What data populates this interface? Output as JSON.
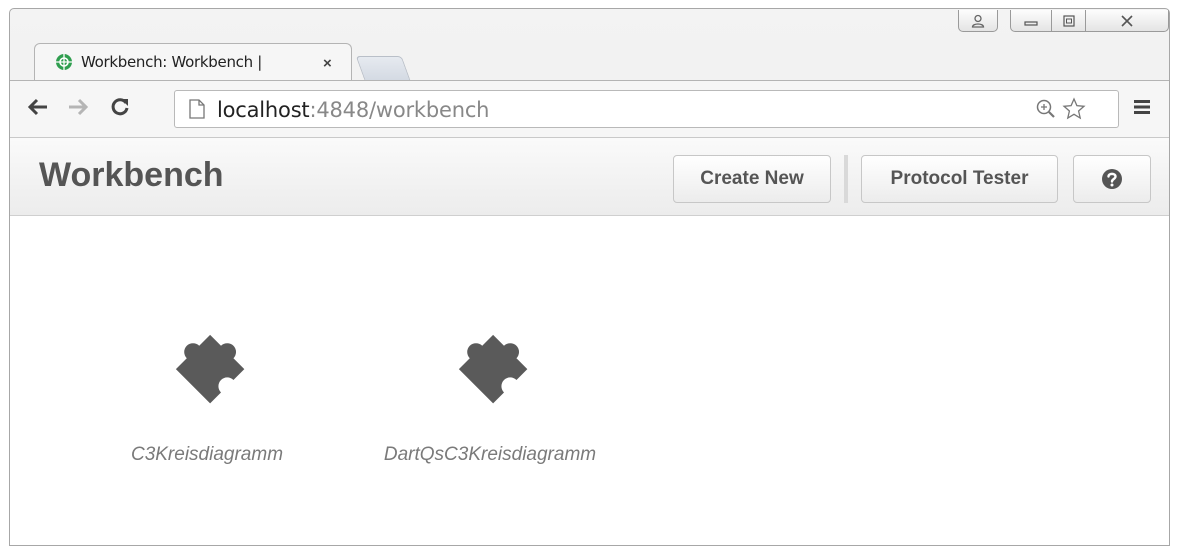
{
  "browser": {
    "tab_title": "Workbench: Workbench |",
    "tab_close": "×",
    "url_host": "localhost",
    "url_rest": ":4848/workbench"
  },
  "app": {
    "title": "Workbench",
    "buttons": {
      "create_new": "Create New",
      "protocol_tester": "Protocol Tester"
    }
  },
  "extensions": [
    {
      "name": "C3Kreisdiagramm",
      "icon": "puzzle-icon"
    },
    {
      "name": "DartQsC3Kreisdiagramm",
      "icon": "puzzle-icon"
    }
  ],
  "colors": {
    "icon": "#5a5a5a",
    "tab_favicon": "#2f9e4f"
  }
}
